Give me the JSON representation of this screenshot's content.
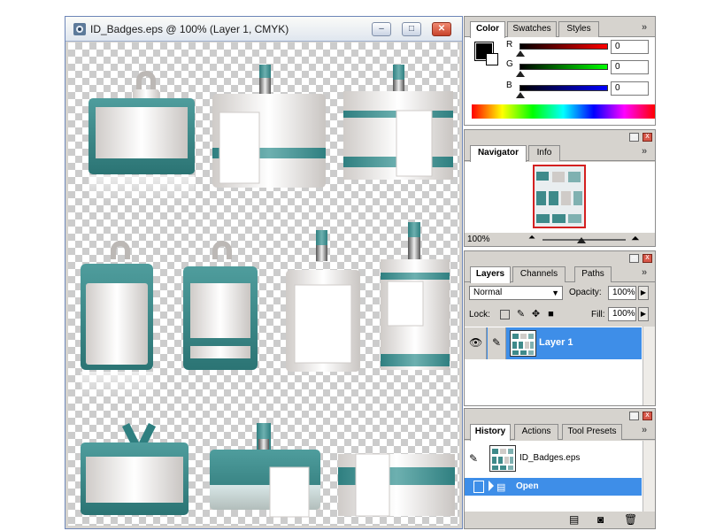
{
  "document": {
    "title": "ID_Badges.eps @ 100% (Layer 1, CMYK)",
    "controls": {
      "minimize": "–",
      "maximize": "□",
      "close": "✕"
    },
    "accent": "#2f7f80"
  },
  "color_palette": {
    "tabs": [
      "Color",
      "Swatches",
      "Styles"
    ],
    "active_tab": "Color",
    "channels": [
      {
        "label": "R",
        "value": "0",
        "color": "#d01515"
      },
      {
        "label": "G",
        "value": "0",
        "color": "#14a814"
      },
      {
        "label": "B",
        "value": "0",
        "color": "#1f1fd0"
      }
    ]
  },
  "navigator_palette": {
    "tabs": [
      "Navigator",
      "Info"
    ],
    "active_tab": "Navigator",
    "zoom": "100%"
  },
  "layers_palette": {
    "tabs": [
      "Layers",
      "Channels",
      "Paths"
    ],
    "active_tab": "Layers",
    "blend_mode": "Normal",
    "opacity_label": "Opacity:",
    "opacity": "100%",
    "lock_label": "Lock:",
    "fill_label": "Fill:",
    "fill": "100%",
    "layers": [
      {
        "name": "Layer 1",
        "selected": true,
        "visible_icon": "eye-icon",
        "brush_icon": "brush-icon"
      }
    ]
  },
  "history_palette": {
    "tabs": [
      "History",
      "Actions",
      "Tool Presets"
    ],
    "active_tab": "History",
    "snapshot_name": "ID_Badges.eps",
    "states": [
      {
        "name": "Open",
        "selected": true
      }
    ]
  },
  "palette_menu_glyph": "»"
}
